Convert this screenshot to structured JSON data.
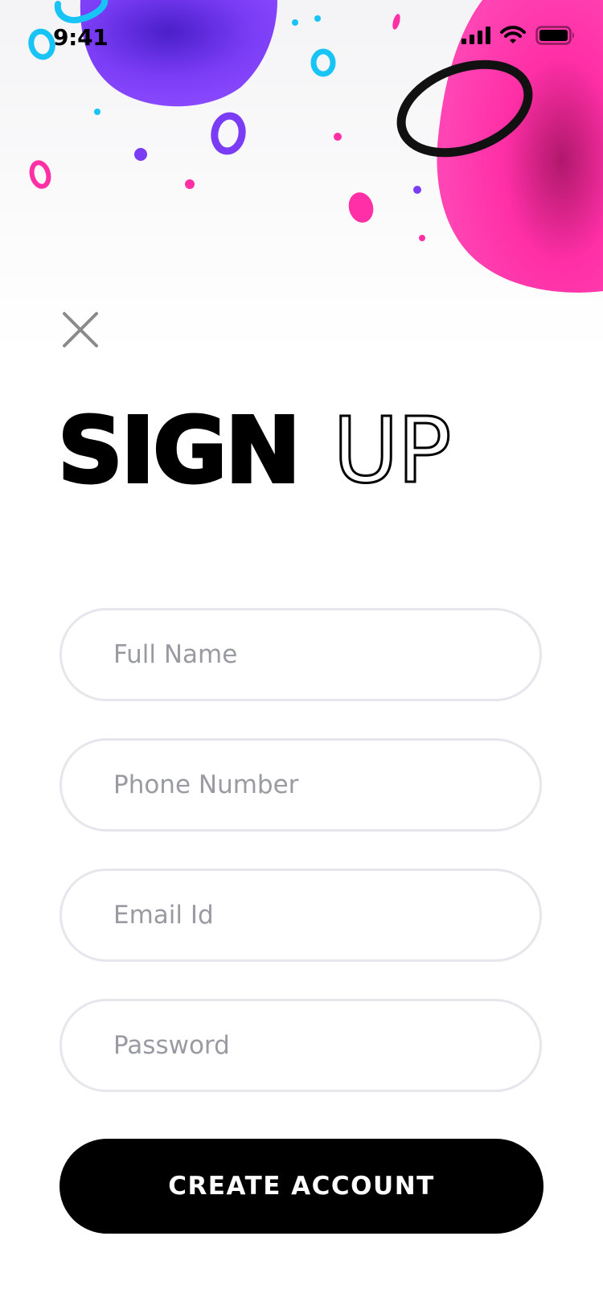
{
  "status_bar": {
    "time": "9:41",
    "icons": [
      "signal-icon",
      "wifi-icon",
      "battery-icon"
    ]
  },
  "header": {
    "close_icon": "close-icon",
    "title_bold": "SIGN",
    "title_outline": "UP"
  },
  "form": {
    "full_name": {
      "placeholder": "Full Name",
      "value": ""
    },
    "phone": {
      "placeholder": "Phone Number",
      "value": ""
    },
    "email": {
      "placeholder": "Email Id",
      "value": ""
    },
    "password": {
      "placeholder": "Password",
      "value": ""
    },
    "submit_label": "CREATE ACCOUNT"
  },
  "colors": {
    "accent_pink": "#ff2fa6",
    "accent_purple": "#7a3cf5",
    "accent_blue": "#18c3f5",
    "button": "#000000",
    "field_border": "#e6e6ec",
    "placeholder": "#9a9aa2"
  }
}
